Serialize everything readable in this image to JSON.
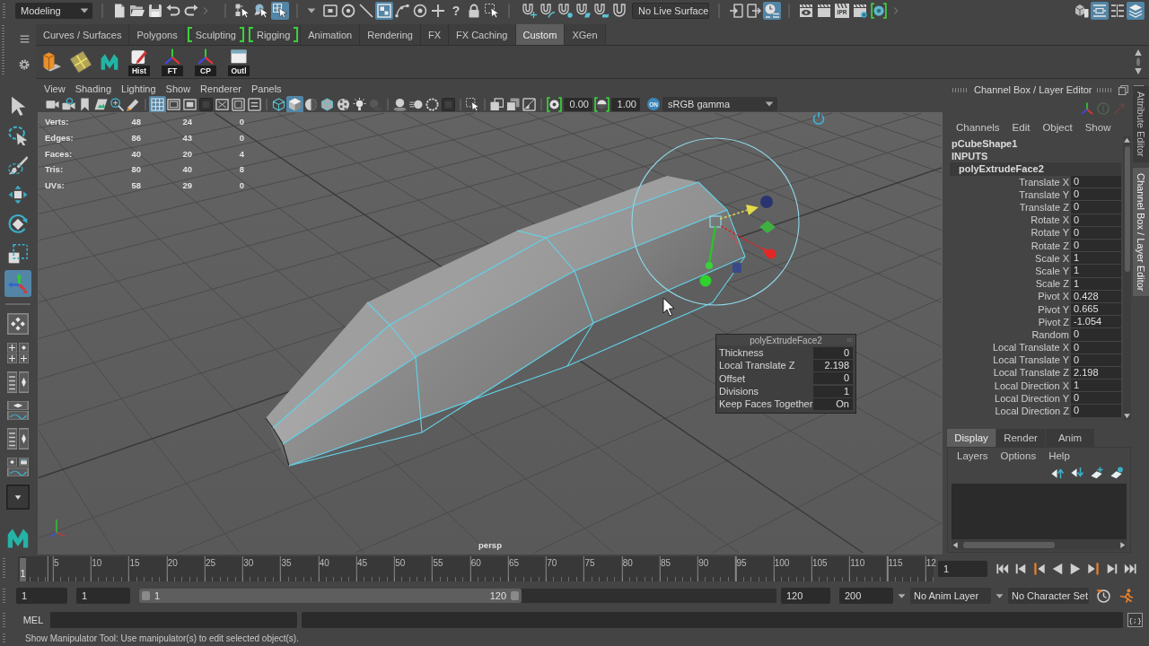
{
  "status_line": {
    "mode_menu": "Modeling",
    "select_modes": [
      {
        "on": false
      },
      {
        "on": false
      },
      {
        "on": true
      }
    ],
    "select_masks": [
      {
        "on": false
      },
      {
        "on": false
      },
      {
        "on": false
      },
      {
        "on": true
      },
      {
        "on": false
      },
      {
        "on": false
      },
      {
        "on": false
      },
      {
        "on": false,
        "glyph": "?"
      },
      {
        "on": false
      },
      {
        "on": false
      }
    ],
    "snap_toggles": [
      {
        "on": false
      },
      {
        "on": false
      },
      {
        "on": false
      },
      {
        "on": false
      },
      {
        "on": false
      },
      {
        "on": false
      }
    ],
    "live_surface": "No Live Surface",
    "history_toggles": [
      {
        "on": false
      },
      {
        "on": false
      },
      {
        "on": true
      }
    ],
    "ipr_label": "IPR",
    "panel_toggles": [
      {
        "on": false
      },
      {
        "on": true
      },
      {
        "on": false
      },
      {
        "on": true
      }
    ]
  },
  "shelf": {
    "tabs": [
      {
        "label": "Curves / Surfaces",
        "selected": false,
        "highlighted": false
      },
      {
        "label": "Polygons",
        "selected": false,
        "highlighted": false
      },
      {
        "label": "Sculpting",
        "selected": false,
        "highlighted": true
      },
      {
        "label": "Rigging",
        "selected": false,
        "highlighted": true
      },
      {
        "label": "Animation",
        "selected": false,
        "highlighted": false
      },
      {
        "label": "Rendering",
        "selected": false,
        "highlighted": false
      },
      {
        "label": "FX",
        "selected": false,
        "highlighted": false
      },
      {
        "label": "FX Caching",
        "selected": false,
        "highlighted": false
      },
      {
        "label": "Custom",
        "selected": true,
        "highlighted": false
      },
      {
        "label": "XGen",
        "selected": false,
        "highlighted": false
      }
    ],
    "buttons": [
      {
        "label": "Hist"
      },
      {
        "label": "FT"
      },
      {
        "label": "CP"
      },
      {
        "label": "Outl"
      }
    ]
  },
  "toolbox": {
    "tools": [
      {
        "on": false
      },
      {
        "on": false
      },
      {
        "on": false
      },
      {
        "on": false
      },
      {
        "on": false
      },
      {
        "on": false
      },
      {
        "on": true
      }
    ]
  },
  "viewport": {
    "menu": [
      "View",
      "Shading",
      "Lighting",
      "Show",
      "Renderer",
      "Panels"
    ],
    "toggles": [
      {
        "on": true
      },
      {
        "on": false
      },
      {
        "on": false
      },
      {
        "on": false
      },
      {
        "on": false
      },
      {
        "on": false
      },
      {
        "on": false
      },
      {
        "on": false
      },
      {
        "on": true
      },
      {
        "on": false
      },
      {
        "on": false
      },
      {
        "on": false
      },
      {
        "on": false
      },
      {
        "on": false
      },
      {
        "on": false
      },
      {
        "on": false
      },
      {
        "on": false
      },
      {
        "on": false
      },
      {
        "on": false
      },
      {
        "on": false
      },
      {
        "on": false
      },
      {
        "on": false
      }
    ],
    "exposure": "0.00",
    "gamma": "1.00",
    "color_management": {
      "on": true,
      "badge": "ON",
      "view": "sRGB gamma"
    },
    "hud": [
      {
        "label": "Verts:",
        "values": [
          "48",
          "24",
          "0"
        ]
      },
      {
        "label": "Edges:",
        "values": [
          "86",
          "43",
          "0"
        ]
      },
      {
        "label": "Faces:",
        "values": [
          "40",
          "20",
          "4"
        ]
      },
      {
        "label": "Tris:",
        "values": [
          "80",
          "40",
          "8"
        ]
      },
      {
        "label": "UVs:",
        "values": [
          "58",
          "29",
          "0"
        ]
      }
    ],
    "camera": "persp",
    "tool_settings": {
      "title": "polyExtrudeFace2",
      "rows": [
        {
          "label": "Thickness",
          "value": "0"
        },
        {
          "label": "Local Translate Z",
          "value": "2.198"
        },
        {
          "label": "Offset",
          "value": "0"
        },
        {
          "label": "Divisions",
          "value": "1"
        },
        {
          "label": "Keep Faces Together",
          "value": "On"
        }
      ]
    }
  },
  "channel_box": {
    "title": "Channel Box / Layer Editor",
    "menu": [
      "Channels",
      "Edit",
      "Object",
      "Show"
    ],
    "object": "pCubeShape1",
    "section": "INPUTS",
    "node": "polyExtrudeFace2",
    "attributes": [
      {
        "name": "Translate X",
        "value": "0"
      },
      {
        "name": "Translate Y",
        "value": "0"
      },
      {
        "name": "Translate Z",
        "value": "0"
      },
      {
        "name": "Rotate X",
        "value": "0"
      },
      {
        "name": "Rotate Y",
        "value": "0"
      },
      {
        "name": "Rotate Z",
        "value": "0"
      },
      {
        "name": "Scale X",
        "value": "1"
      },
      {
        "name": "Scale Y",
        "value": "1"
      },
      {
        "name": "Scale Z",
        "value": "1"
      },
      {
        "name": "Pivot X",
        "value": "0.428"
      },
      {
        "name": "Pivot Y",
        "value": "0.665"
      },
      {
        "name": "Pivot Z",
        "value": "-1.054"
      },
      {
        "name": "Random",
        "value": "0"
      },
      {
        "name": "Local Translate X",
        "value": "0"
      },
      {
        "name": "Local Translate Y",
        "value": "0"
      },
      {
        "name": "Local Translate Z",
        "value": "2.198"
      },
      {
        "name": "Local Direction X",
        "value": "1"
      },
      {
        "name": "Local Direction Y",
        "value": "0"
      },
      {
        "name": "Local Direction Z",
        "value": "0"
      }
    ]
  },
  "layer_editor": {
    "tabs": [
      {
        "label": "Display",
        "selected": true
      },
      {
        "label": "Render",
        "selected": false
      },
      {
        "label": "Anim",
        "selected": false
      }
    ],
    "menu": [
      "Layers",
      "Options",
      "Help"
    ]
  },
  "side_tabs": [
    {
      "label": "Attribute Editor",
      "selected": false
    },
    {
      "label": "Channel Box / Layer Editor",
      "selected": true
    }
  ],
  "timeline": {
    "current_frame": "1",
    "level": 0,
    "ticks": [
      "5",
      "10",
      "15",
      "20",
      "25",
      "30",
      "35",
      "40",
      "45",
      "50",
      "55",
      "60",
      "65",
      "70",
      "75",
      "80",
      "85",
      "90",
      "95",
      "100",
      "105",
      "110",
      "115",
      "12"
    ],
    "frame_field": "1"
  },
  "range_slider": {
    "animation_start": "1",
    "playback_start": "1",
    "range_start": "1",
    "range_end": "120",
    "level": 0.6,
    "playback_end": "120",
    "animation_end": "200",
    "anim_layer": "No Anim Layer",
    "character_set": "No Character Set"
  },
  "command_line": {
    "language": "MEL",
    "script_editor": "{;}"
  },
  "help_line": "Show Manipulator Tool: Use manipulator(s) to edit selected object(s)."
}
